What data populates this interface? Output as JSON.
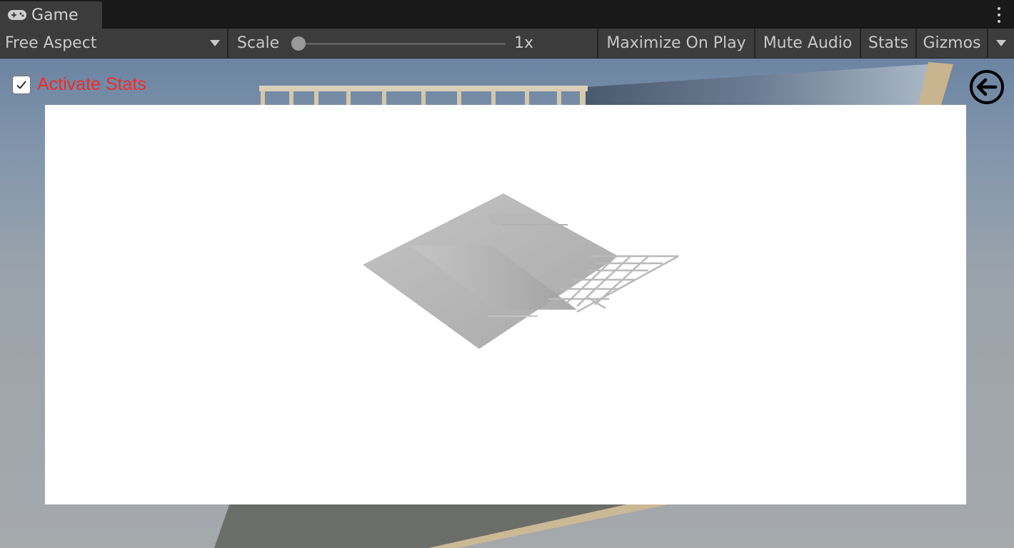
{
  "tab": {
    "title": "Game",
    "icon": "gamepad-icon"
  },
  "toolbar": {
    "aspect": "Free Aspect",
    "scale_label": "Scale",
    "scale_value": "1x",
    "scale_fraction": 0.0,
    "maximize": "Maximize On Play",
    "mute": "Mute Audio",
    "stats": "Stats",
    "gizmos": "Gizmos"
  },
  "overlay": {
    "activate_stats_label": "Activate Stats",
    "activate_stats_checked": true,
    "activate_stats_color": "#ee2b2b",
    "back_icon": "arrow-left-circle-icon"
  },
  "colors": {
    "editor_bg": "#191919",
    "toolbar_bg": "#3c3c3c",
    "panel_bg": "#ffffff"
  }
}
